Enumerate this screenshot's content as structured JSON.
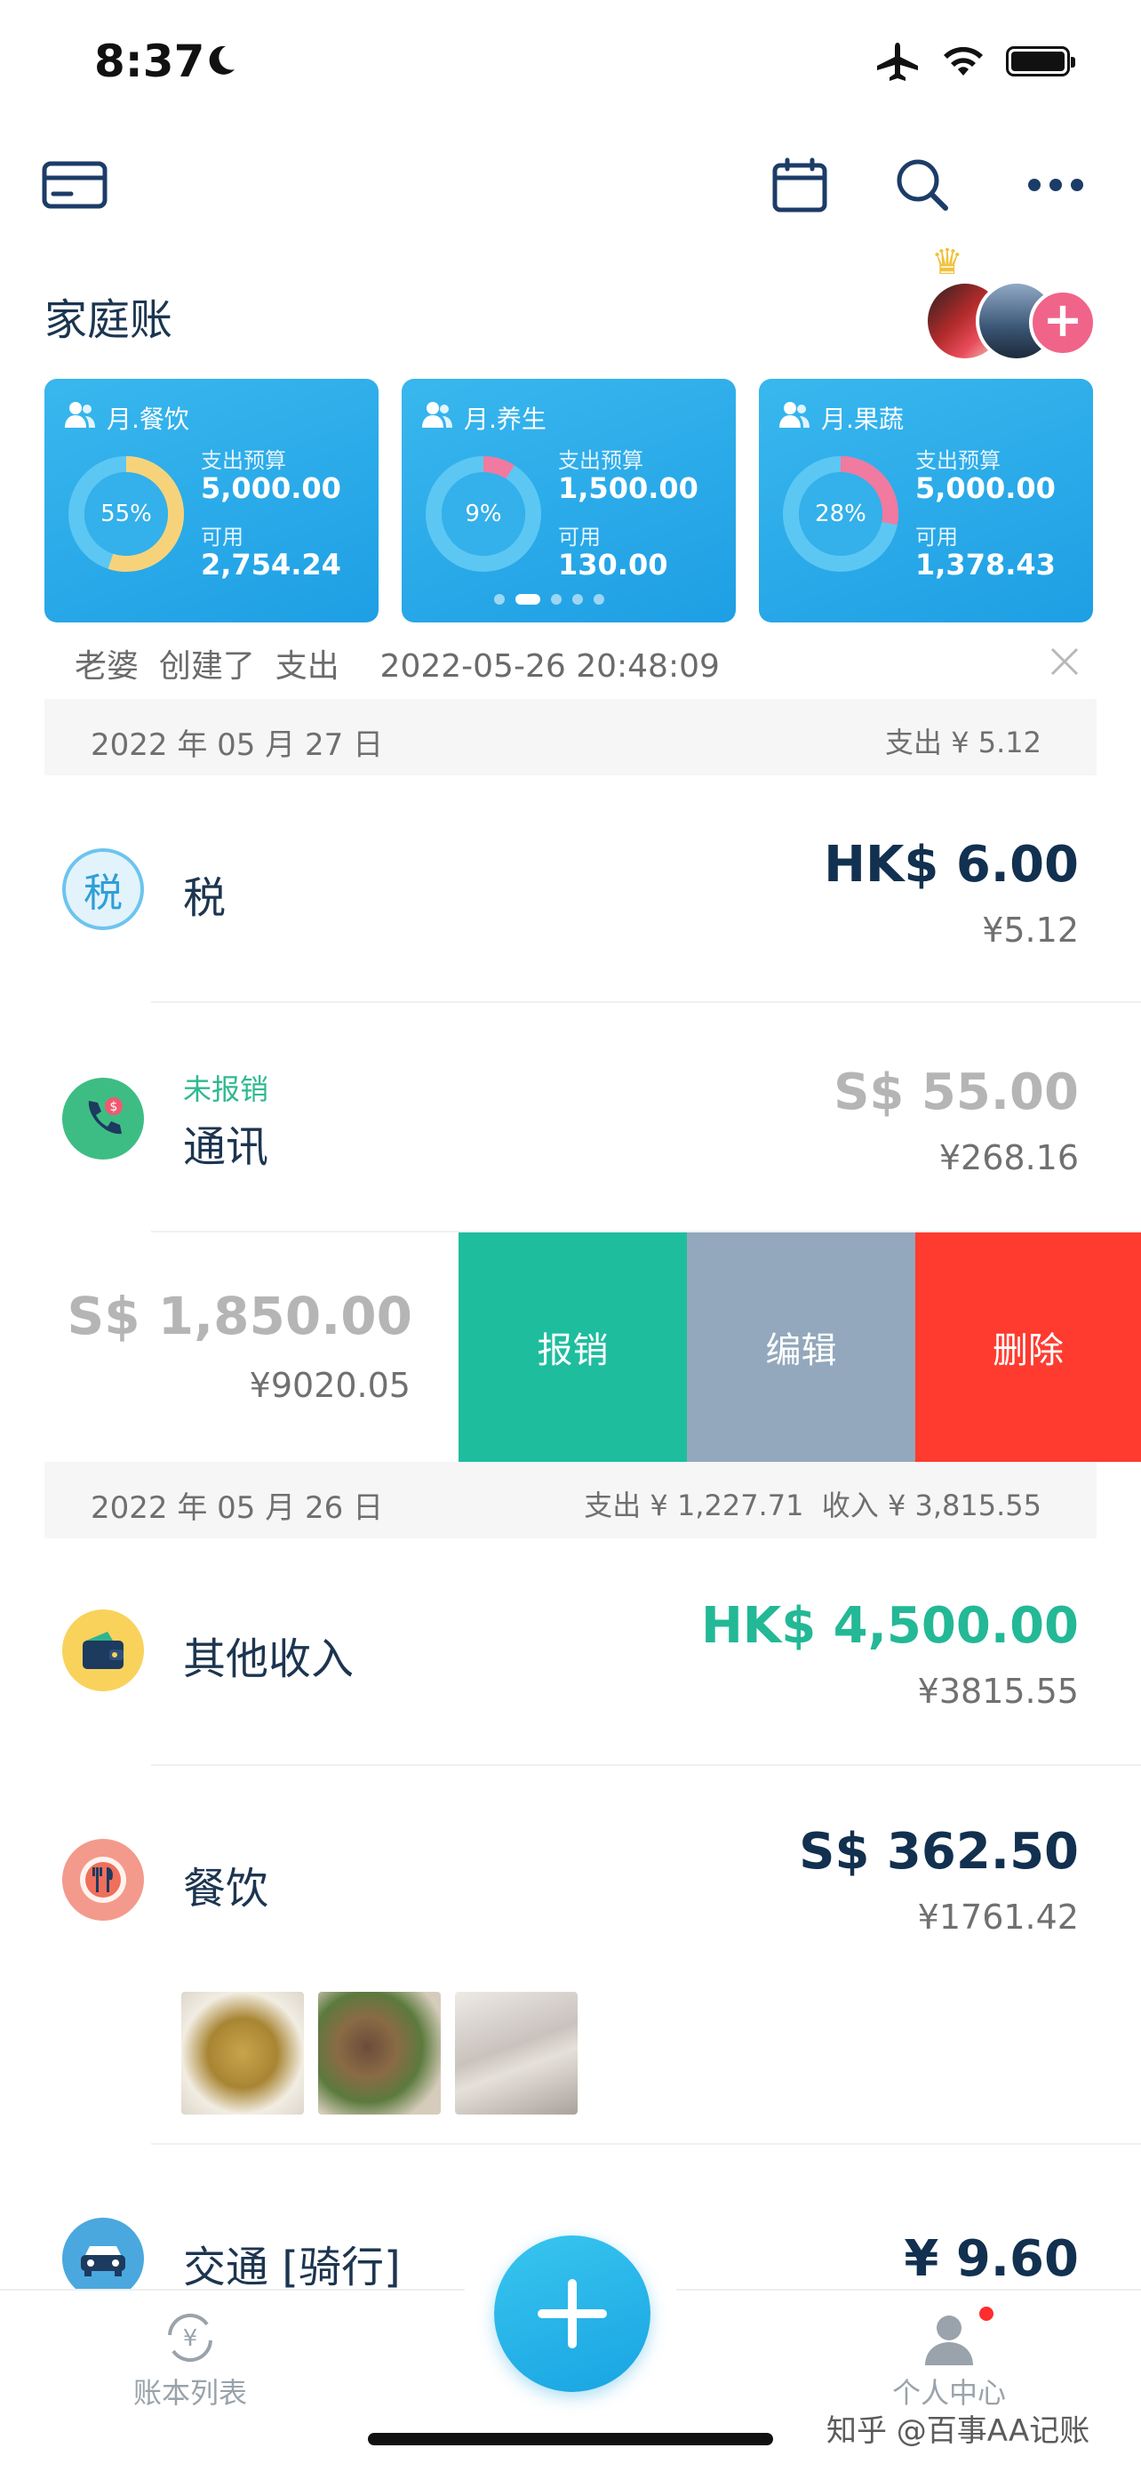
{
  "status_bar": {
    "time": "8:37"
  },
  "header": {
    "title": "家庭账"
  },
  "budget_cards": [
    {
      "title": "月.餐饮",
      "percent_label": "55%",
      "used_fraction": 0.55,
      "ring_color": "#f6d37a",
      "budget_label": "支出预算",
      "budget": "5,000.00",
      "available_label": "可用",
      "available": "2,754.24"
    },
    {
      "title": "月.养生",
      "percent_label": "9%",
      "used_fraction": 0.09,
      "ring_color": "#f07aa0",
      "budget_label": "支出预算",
      "budget": "1,500.00",
      "available_label": "可用",
      "available": "130.00"
    },
    {
      "title": "月.果蔬",
      "percent_label": "28%",
      "used_fraction": 0.28,
      "ring_color": "#f07aa0",
      "budget_label": "支出预算",
      "budget": "5,000.00",
      "available_label": "可用",
      "available": "1,378.43"
    }
  ],
  "activity_text": "老婆  创建了  支出    2022-05-26 20:48:09",
  "groups": [
    {
      "date": "2022 年 05 月 27 日",
      "summary": "支出 ¥ 5.12"
    },
    {
      "date": "2022 年 05 月 26 日",
      "summary": "支出 ¥ 1,227.71  收入 ¥ 3,815.55"
    }
  ],
  "transactions": [
    {
      "icon": "tax-icon",
      "icon_char": "税",
      "name": "税",
      "amount": "HK$ 6.00",
      "converted": "¥5.12",
      "amount_color": "#12304f"
    },
    {
      "icon": "phone-icon",
      "name": "通讯",
      "tag": "未报销",
      "amount": "S$ 55.00",
      "converted": "¥268.16",
      "amount_color": "#b5b5b5"
    },
    {
      "name": "",
      "amount": "S$ 1,850.00",
      "converted": "¥9020.05",
      "amount_color": "#b5b5b5"
    },
    {
      "icon": "wallet-icon",
      "name": "其他收入",
      "amount": "HK$ 4,500.00",
      "converted": "¥3815.55",
      "amount_color": "#23b896"
    },
    {
      "icon": "dining-icon",
      "name": "餐饮",
      "amount": "S$ 362.50",
      "converted": "¥1761.42",
      "amount_color": "#12304f"
    },
    {
      "icon": "car-icon",
      "name": "交通 [骑行]",
      "amount": "¥ 9.60",
      "amount_color": "#12304f"
    }
  ],
  "swipe_actions": {
    "reimburse": "报销",
    "edit": "编辑",
    "delete": "删除"
  },
  "colors": {
    "reimburse": "#1ebd9e",
    "edit": "#93a8bc",
    "delete": "#ff3b30"
  },
  "tabbar": {
    "left": "账本列表",
    "right": "个人中心"
  },
  "watermark": "知乎 @百事AA记账"
}
